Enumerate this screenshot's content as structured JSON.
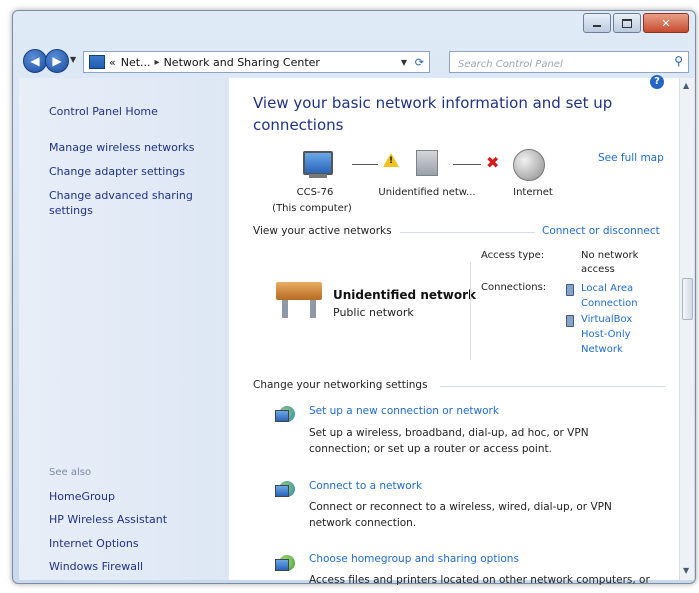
{
  "window": {
    "caption_buttons": {
      "minimize": "minimize",
      "maximize": "maximize",
      "close": "✕"
    }
  },
  "address_bar": {
    "crumbs": [
      "«",
      "Net...",
      "▸",
      "Network and Sharing Center"
    ],
    "search_placeholder": "Search Control Panel"
  },
  "sidebar": {
    "home": "Control Panel Home",
    "links": [
      "Manage wireless networks",
      "Change adapter settings",
      "Change advanced sharing",
      "settings"
    ],
    "see_also_label": "See also",
    "see_also": [
      "HomeGroup",
      "HP Wireless Assistant",
      "Internet Options",
      "Windows Firewall"
    ]
  },
  "main": {
    "heading_line1": "View your basic network information and set up",
    "heading_line2": "connections",
    "see_full_map": "See full map",
    "map": {
      "computer": "CCS-76",
      "computer_sub": "(This computer)",
      "network": "Unidentified netw...",
      "internet": "Internet"
    },
    "active_networks_label": "View your active networks",
    "connect_disconnect": "Connect or disconnect",
    "network_name": "Unidentified network",
    "network_type": "Public network",
    "access_type_key": "Access type:",
    "access_type_val_1": "No network",
    "access_type_val_2": "access",
    "connections_key": "Connections:",
    "connections": [
      {
        "line1": "Local Area",
        "line2": "Connection"
      },
      {
        "line1": "VirtualBox",
        "line2": "Host-Only",
        "line3": "Network"
      }
    ],
    "change_settings_label": "Change your networking settings",
    "tasks": [
      {
        "title": "Set up a new connection or network",
        "desc1": "Set up a wireless, broadband, dial-up, ad hoc, or VPN",
        "desc2": "connection; or set up a router or access point."
      },
      {
        "title": "Connect to a network",
        "desc1": "Connect or reconnect to a wireless, wired, dial-up, or VPN",
        "desc2": "network connection."
      },
      {
        "title": "Choose homegroup and sharing options",
        "desc1": "Access files and printers located on other network computers, or"
      }
    ]
  }
}
